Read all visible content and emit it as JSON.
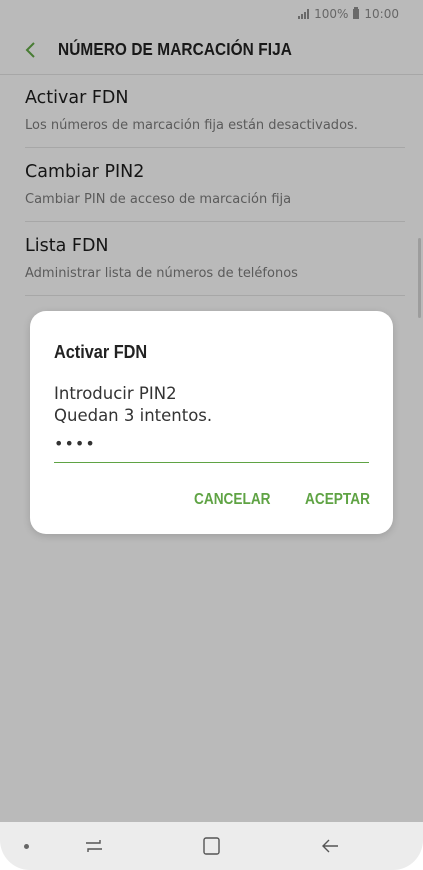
{
  "status_bar": {
    "battery": "100%",
    "time": "10:00",
    "signal_icon": "signal-icon",
    "battery_icon": "battery-icon"
  },
  "app_bar": {
    "title": "NÚMERO DE MARCACIÓN FIJA",
    "back_icon": "chevron-left-icon"
  },
  "settings": [
    {
      "title": "Activar FDN",
      "subtitle": "Los números de marcación fija están desactivados."
    },
    {
      "title": "Cambiar PIN2",
      "subtitle": "Cambiar PIN de acceso de marcación fija"
    },
    {
      "title": "Lista FDN",
      "subtitle": "Administrar lista de números de teléfonos"
    }
  ],
  "dialog": {
    "title": "Activar FDN",
    "message_line1": "Introducir PIN2",
    "message_line2": "Quedan 3 intentos.",
    "pin_value": "••••",
    "cancel_label": "CANCELAR",
    "accept_label": "ACEPTAR"
  },
  "nav_bar": {
    "icons": [
      "dot-icon",
      "recents-icon",
      "home-icon",
      "back-arrow-icon"
    ]
  },
  "colors": {
    "accent": "#5fa344",
    "background": "#f5f5f5",
    "text_primary": "#1c1c1c",
    "text_secondary": "#787878"
  }
}
